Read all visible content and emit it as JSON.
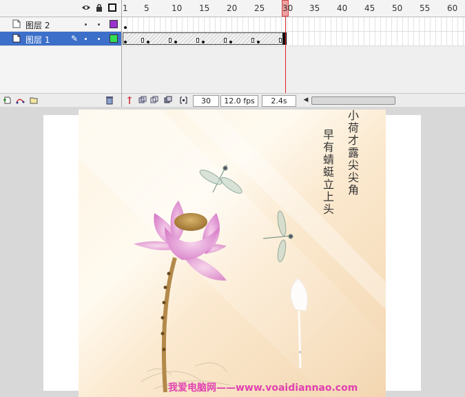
{
  "timeline": {
    "header_icons": [
      "eye-icon",
      "lock-icon",
      "outline-icon"
    ],
    "layers": [
      {
        "name": "图层 2",
        "swatch_color": "#9933cc",
        "selected": false
      },
      {
        "name": "图层 1",
        "swatch_color": "#33dd55",
        "selected": true
      }
    ],
    "ruler_numbers": [
      "1",
      "5",
      "10",
      "15",
      "20",
      "25",
      "30",
      "35",
      "40",
      "45",
      "50",
      "55",
      "60"
    ],
    "current_frame": "30",
    "fps": "12.0 fps",
    "elapsed": "2.4s"
  },
  "artwork": {
    "poem_lines": [
      "小荷才露尖尖角",
      "早有蜻蜓立上头"
    ],
    "watermark": "我爱电脑网——www.voaidiannao.com"
  }
}
